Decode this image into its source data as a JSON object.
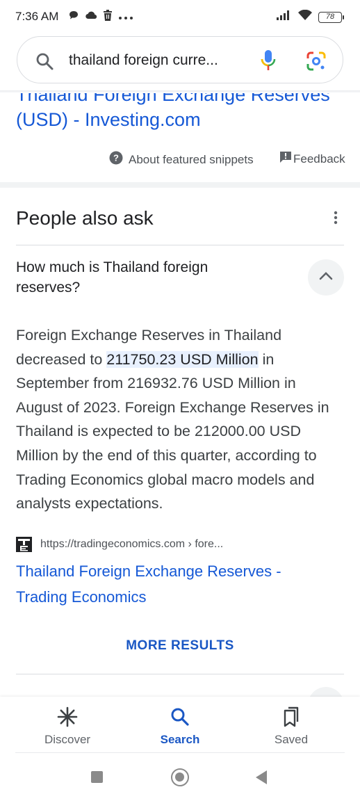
{
  "status_bar": {
    "time": "7:36 AM",
    "left_icons": [
      "chat-bubble-icon",
      "cloud-icon",
      "trash-icon",
      "more-dots-icon"
    ],
    "battery": "78"
  },
  "search": {
    "query": "thailand foreign curre...",
    "icons": [
      "search-icon",
      "mic-icon",
      "lens-icon"
    ]
  },
  "featured_snippet": {
    "link_title": "Thailand Foreign Exchange Reserves (USD) - Investing.com",
    "about_label": "About featured snippets",
    "feedback_label": "Feedback"
  },
  "people_also_ask": {
    "title": "People also ask",
    "question": "How much is Thailand foreign reserves?",
    "answer_before": "Foreign Exchange Reserves in Thailand decreased to ",
    "answer_highlight": "211750.23 USD Million",
    "answer_after": " in September from 216932.76 USD Million in August of 2023. Foreign Exchange Reserves in Thailand is expected to be 212000.00 USD Million by the end of this quarter, according to Trading Economics global macro models and analysts expectations.",
    "source_logo": "TE",
    "source_url": "https://tradingeconomics.com › fore...",
    "result_title": "Thailand Foreign Exchange Reserves - Trading Economics",
    "more_results": "MORE RESULTS"
  },
  "bottom_nav": {
    "items": [
      {
        "label": "Discover",
        "icon": "asterisk-icon",
        "active": false
      },
      {
        "label": "Search",
        "icon": "search-icon",
        "active": true
      },
      {
        "label": "Saved",
        "icon": "bookmarks-icon",
        "active": false
      }
    ]
  },
  "colors": {
    "link": "#1558d6",
    "accent": "#1a57c4",
    "highlight": "#e8f0fe"
  }
}
